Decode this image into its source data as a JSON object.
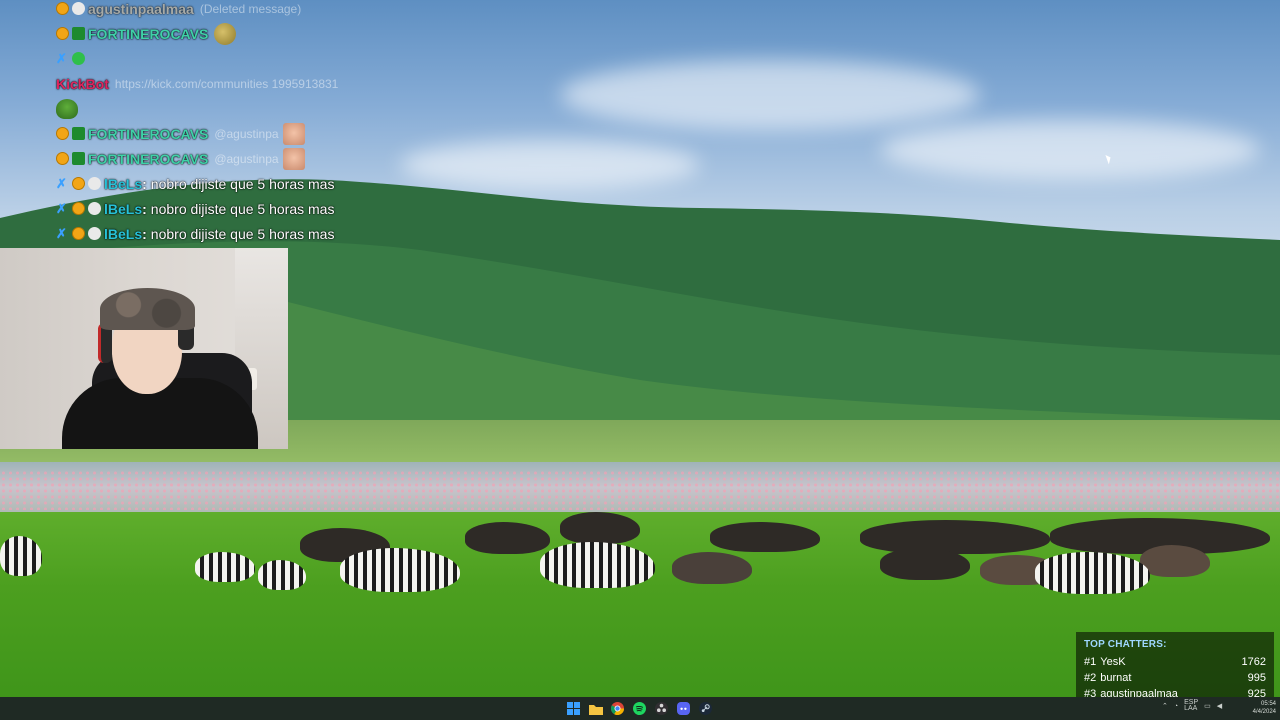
{
  "chat": {
    "messages": [
      {
        "username": "agustinpaalmaa",
        "text": "(Deleted message)",
        "faded": true
      },
      {
        "username": "FORTINEROCAVS",
        "emote": "face-emote"
      },
      {
        "badges_only": true
      },
      {
        "username": "KickBot",
        "text": "https://kick.com/communities 1995913831",
        "faded": true
      },
      {
        "emote": "pepe-emote"
      },
      {
        "username": "FORTINEROCAVS",
        "text": "@agustinpa",
        "faded": true,
        "emote": "kiss-emote"
      },
      {
        "username": "FORTINEROCAVS",
        "text": "@agustinpa",
        "faded": true,
        "emote": "kiss-emote"
      },
      {
        "username": "lBeLs",
        "text": "nobro dijiste que 5 horas mas"
      },
      {
        "username": "lBeLs",
        "text": "nobro dijiste que 5 horas mas"
      },
      {
        "username": "lBeLs",
        "text": "nobro dijiste que 5 horas mas"
      }
    ]
  },
  "top_chatters": {
    "title": "TOP CHATTERS:",
    "rows": [
      {
        "rank": "#1",
        "name": "YesK",
        "count": "1762"
      },
      {
        "rank": "#2",
        "name": "burnat",
        "count": "995"
      },
      {
        "rank": "#3",
        "name": "agustinpaalmaa",
        "count": "925"
      }
    ]
  },
  "taskbar": {
    "apps": [
      "windows-start-icon",
      "file-explorer-icon",
      "chrome-icon",
      "spotify-icon",
      "obs-icon",
      "discord-icon",
      "steam-icon"
    ],
    "tray_lang": "ESP",
    "tray_sub": "LAA",
    "clock_time": "05:54",
    "clock_date": "4/4/2024"
  },
  "colors": {
    "name_green": "#3fd1a8",
    "name_pink": "#e0245e",
    "name_cyan": "#27c2d8",
    "taskbar_bg": "#1f2a24"
  }
}
